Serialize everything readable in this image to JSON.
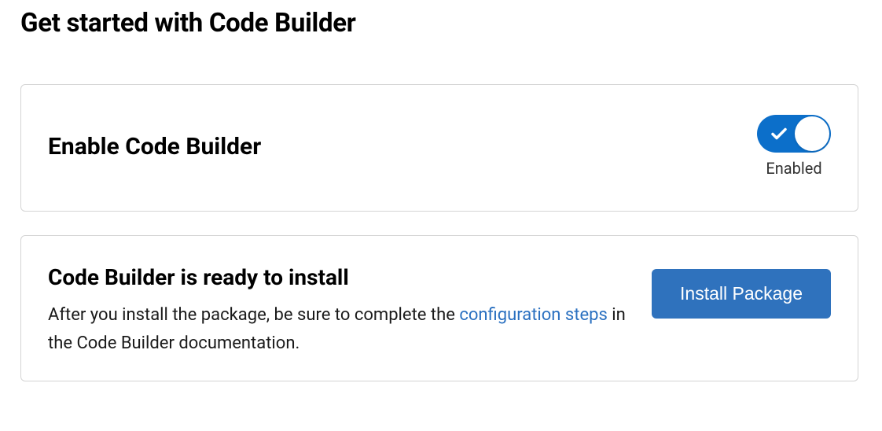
{
  "page": {
    "title": "Get started with Code Builder"
  },
  "enable_card": {
    "title": "Enable Code Builder",
    "toggle": {
      "state_label": "Enabled",
      "enabled": true
    }
  },
  "install_card": {
    "title": "Code Builder is ready to install",
    "desc_before": "After you install the package, be sure to complete the ",
    "desc_link": "configuration steps",
    "desc_after": " in the Code Builder documentation.",
    "button_label": "Install Package"
  }
}
